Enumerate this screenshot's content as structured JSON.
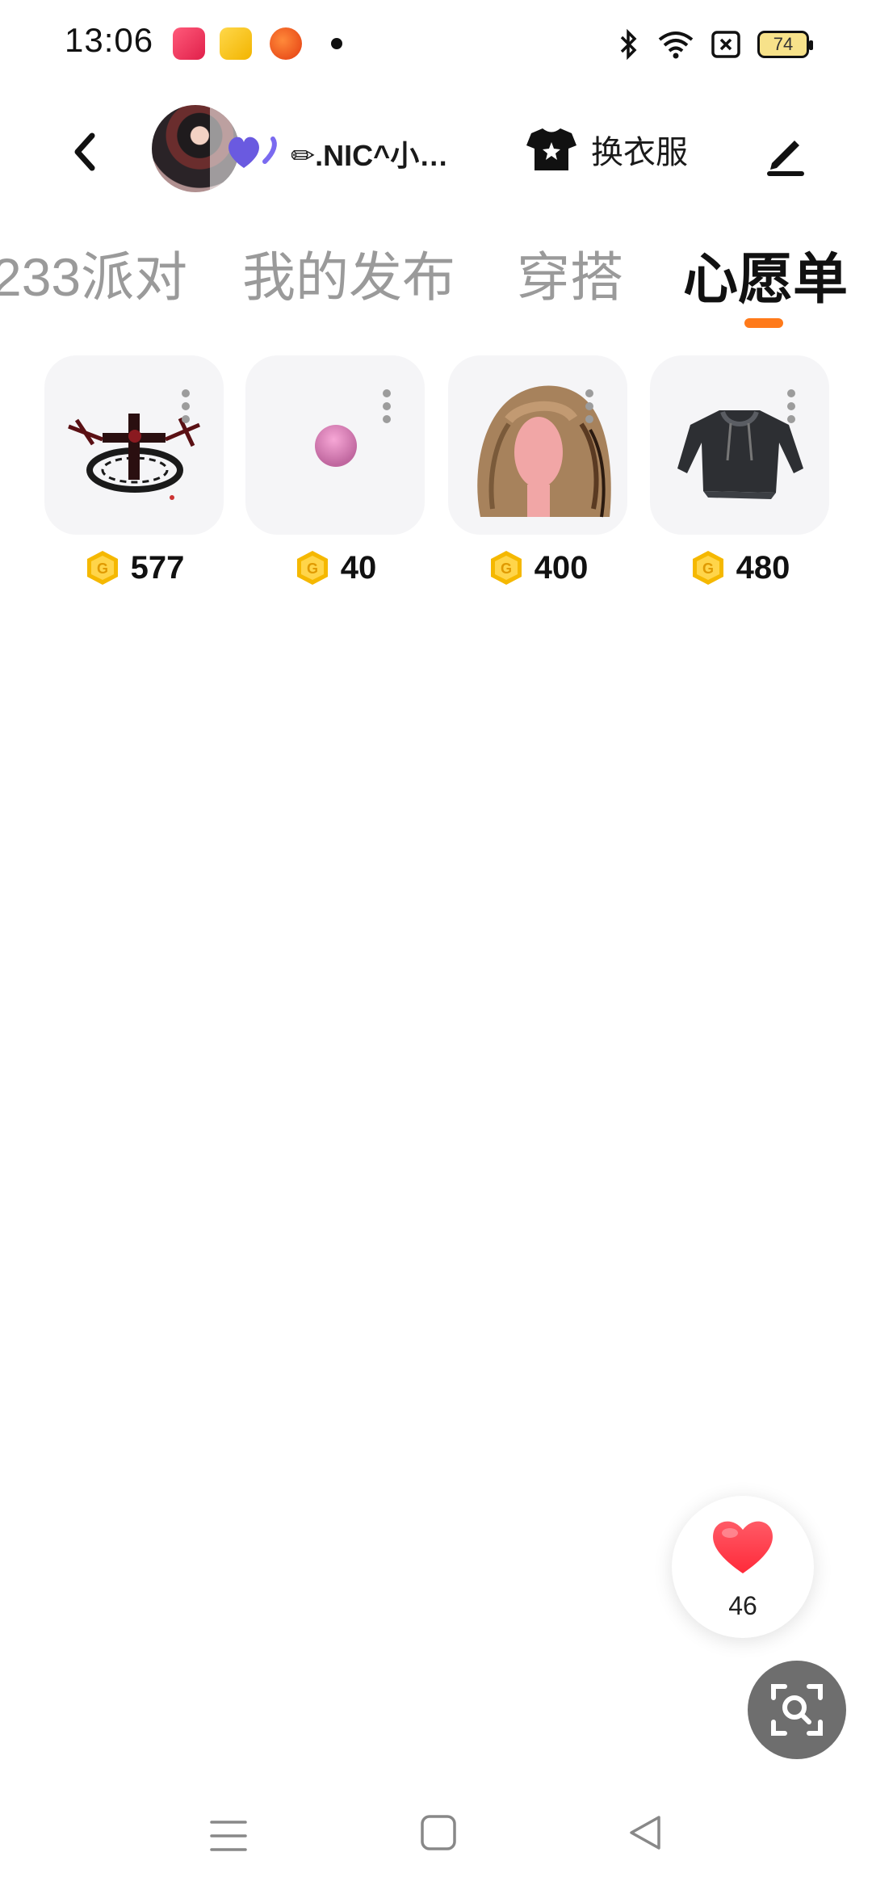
{
  "status_bar": {
    "time": "13:06",
    "battery": "74",
    "icons": [
      "music-app-icon",
      "heart-app-icon",
      "ball-app-icon",
      "bluetooth-icon",
      "wifi-icon",
      "sim-icon",
      "battery-icon"
    ]
  },
  "header": {
    "user_name": "✏.NIC^小…",
    "outfit_label": "换衣服",
    "icons": [
      "back-icon",
      "heart-badge-icon",
      "tshirt-star-icon",
      "edit-icon"
    ]
  },
  "tabs": [
    {
      "label": "233派对"
    },
    {
      "label": "我的发布"
    },
    {
      "label": "穿搭"
    },
    {
      "label": "心愿单",
      "selected": true
    }
  ],
  "wishlist": [
    {
      "price": "577",
      "image": "gothic-cross-emblem"
    },
    {
      "price": "40",
      "image": "pink-ball"
    },
    {
      "price": "400",
      "image": "wavy-hair-wig"
    },
    {
      "price": "480",
      "image": "dark-hoodie"
    }
  ],
  "like": {
    "count": "46"
  },
  "colors": {
    "accent": "#ff7a1a",
    "coin": "#f5b800",
    "like": "#ff3b4d"
  }
}
